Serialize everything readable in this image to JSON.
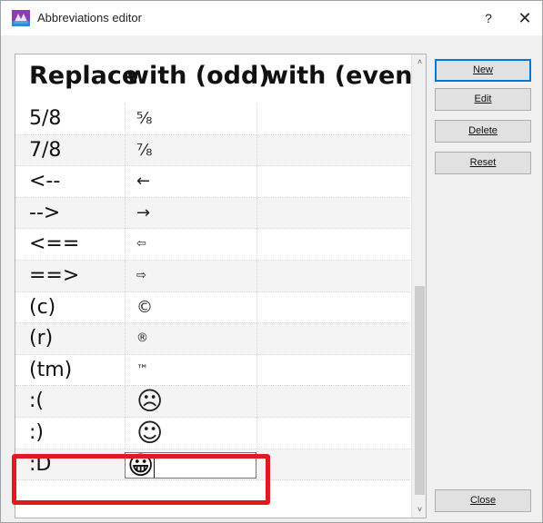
{
  "window": {
    "title": "Abbreviations editor",
    "help_label": "?",
    "close_label": "✕"
  },
  "grid": {
    "headers": [
      "Replace",
      "with (odd)",
      "with (even)"
    ],
    "rows": [
      {
        "replace": "5/8",
        "odd": "⅝",
        "even": ""
      },
      {
        "replace": "7/8",
        "odd": "⅞",
        "even": ""
      },
      {
        "replace": "<--",
        "odd": "←",
        "even": ""
      },
      {
        "replace": "-->",
        "odd": "→",
        "even": ""
      },
      {
        "replace": "<==",
        "odd": "⇦",
        "even": ""
      },
      {
        "replace": "==>",
        "odd": "⇨",
        "even": ""
      },
      {
        "replace": "(c)",
        "odd": "©",
        "even": ""
      },
      {
        "replace": "(r)",
        "odd": "®",
        "even": ""
      },
      {
        "replace": "(tm)",
        "odd": "™",
        "even": ""
      },
      {
        "replace": ":(",
        "odd": "☹",
        "even": ""
      },
      {
        "replace": ":)",
        "odd": "☺",
        "even": ""
      },
      {
        "replace": ":D",
        "odd": "😀",
        "even": ""
      }
    ]
  },
  "buttons": {
    "new": "New",
    "edit": "Edit",
    "delete": "Delete",
    "reset": "Reset",
    "close": "Close"
  },
  "scrollbar": {
    "up_glyph": "˄",
    "down_glyph": "˅"
  },
  "colors": {
    "highlight": "#e01a22",
    "default_button_border": "#0078d7"
  }
}
